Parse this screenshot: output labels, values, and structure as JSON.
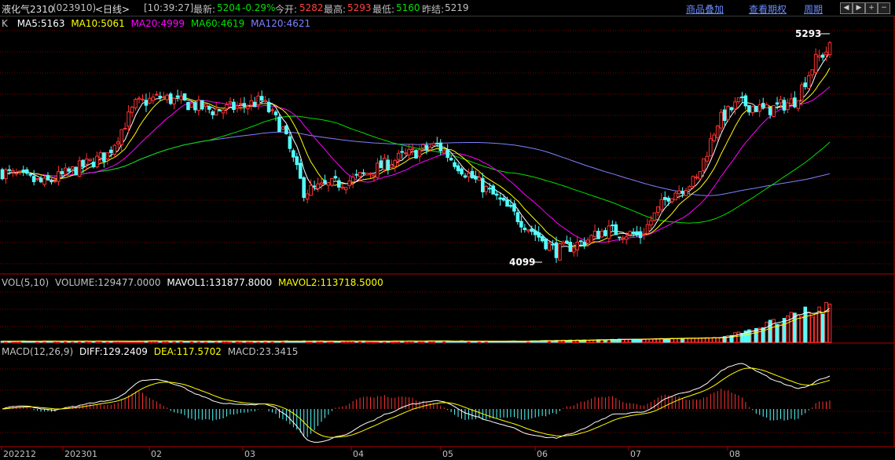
{
  "header": {
    "name": "液化气2310",
    "code": "(023910)",
    "period": "<日线>",
    "time": "[10:39:27]",
    "latest_label": "最新:",
    "latest_value": "5204",
    "change": "-0.29%",
    "open_label": "今开:",
    "open_value": "5282",
    "high_label": "最高:",
    "high_value": "5293",
    "low_label": "最低:",
    "low_value": "5160",
    "prevclose_label": "昨结:",
    "prevclose_value": "5219",
    "links": [
      "商品叠加",
      "查看期权",
      "周期"
    ]
  },
  "kline_legend": {
    "prefix": "K",
    "ma5": "MA5:5163",
    "ma10": "MA10:5061",
    "ma20": "MA20:4999",
    "ma60": "MA60:4619",
    "ma120": "MA120:4621"
  },
  "annotations": {
    "high": "5293",
    "low": "4099"
  },
  "volume_legend": {
    "vol": "VOL(5,10)",
    "volume": "VOLUME:129477.0000",
    "mavol1": "MAVOL1:131877.8000",
    "mavol2": "MAVOL2:113718.5000"
  },
  "macd_legend": {
    "macd_name": "MACD(12,26,9)",
    "diff": "DIFF:129.2409",
    "dea": "DEA:117.5702",
    "macd": "MACD:23.3415"
  },
  "x_axis": [
    "202212",
    "202301",
    "02",
    "03",
    "04",
    "05",
    "06",
    "07",
    "08"
  ],
  "colors": {
    "up": "#ff3232",
    "down": "#54ffff",
    "ma5": "#ffffff",
    "ma10": "#ffff00",
    "ma20": "#ff00ff",
    "ma60": "#00e000",
    "ma120": "#8080ff",
    "grid": "#7a0000"
  },
  "chart_data": {
    "type": "candlestick",
    "price_anchors": [
      {
        "t": 0,
        "v": 4560
      },
      {
        "t": 12,
        "v": 4500
      },
      {
        "t": 30,
        "v": 4650
      },
      {
        "t": 38,
        "v": 4910
      },
      {
        "t": 45,
        "v": 4950
      },
      {
        "t": 60,
        "v": 4880
      },
      {
        "t": 68,
        "v": 4900
      },
      {
        "t": 74,
        "v": 4930
      },
      {
        "t": 80,
        "v": 4780
      },
      {
        "t": 86,
        "v": 4460
      },
      {
        "t": 100,
        "v": 4520
      },
      {
        "t": 114,
        "v": 4640
      },
      {
        "t": 124,
        "v": 4700
      },
      {
        "t": 132,
        "v": 4560
      },
      {
        "t": 140,
        "v": 4440
      },
      {
        "t": 152,
        "v": 4240
      },
      {
        "t": 158,
        "v": 4150
      },
      {
        "t": 166,
        "v": 4200
      },
      {
        "t": 172,
        "v": 4260
      },
      {
        "t": 182,
        "v": 4230
      },
      {
        "t": 190,
        "v": 4440
      },
      {
        "t": 198,
        "v": 4520
      },
      {
        "t": 204,
        "v": 4820
      },
      {
        "t": 210,
        "v": 4920
      },
      {
        "t": 218,
        "v": 4880
      },
      {
        "t": 226,
        "v": 4930
      },
      {
        "t": 232,
        "v": 5140
      },
      {
        "t": 236,
        "v": 5204
      }
    ],
    "high": 5293,
    "low": 4099
  }
}
